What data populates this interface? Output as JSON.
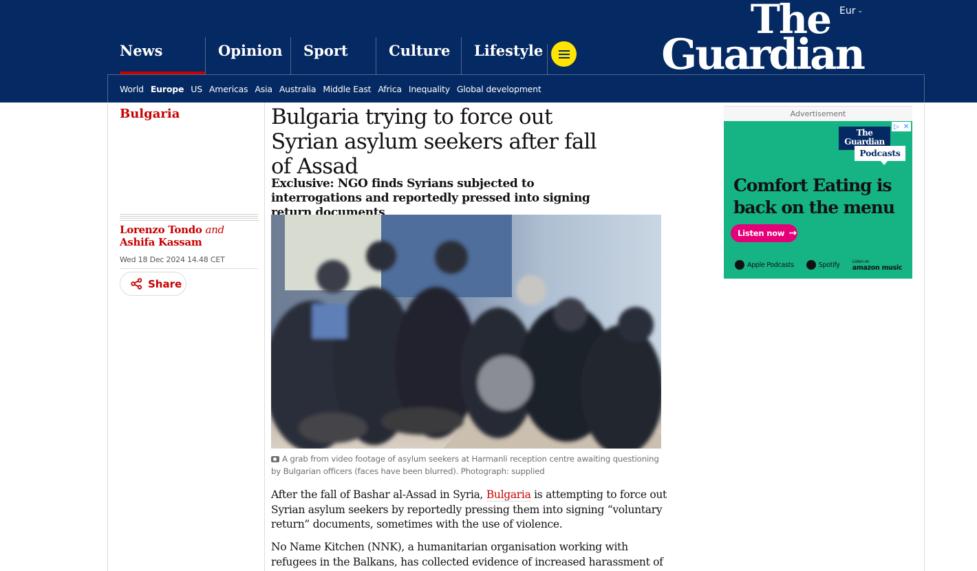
{
  "header": {
    "edition": "Eur",
    "logo_line1": "The",
    "logo_line2": "Guardian",
    "pillars": [
      {
        "label": "News",
        "active": true
      },
      {
        "label": "Opinion",
        "active": false
      },
      {
        "label": "Sport",
        "active": false
      },
      {
        "label": "Culture",
        "active": false
      },
      {
        "label": "Lifestyle",
        "active": false
      }
    ],
    "subnav": [
      {
        "label": "World",
        "current": false
      },
      {
        "label": "Europe",
        "current": true
      },
      {
        "label": "US",
        "current": false
      },
      {
        "label": "Americas",
        "current": false
      },
      {
        "label": "Asia",
        "current": false
      },
      {
        "label": "Australia",
        "current": false
      },
      {
        "label": "Middle East",
        "current": false
      },
      {
        "label": "Africa",
        "current": false
      },
      {
        "label": "Inequality",
        "current": false
      },
      {
        "label": "Global development",
        "current": false
      }
    ],
    "colors": {
      "brand": "#052962",
      "accent": "#c70000",
      "menu_button": "#ffe500"
    }
  },
  "meta": {
    "section": "Bulgaria",
    "author1": "Lorenzo Tondo",
    "and_text": "and",
    "author2": "Ashifa Kassam",
    "date": "Wed 18 Dec 2024 14.48 CET",
    "share_label": "Share"
  },
  "article": {
    "headline": "Bulgaria trying to force out Syrian asylum seekers after fall of Assad",
    "standfirst": "Exclusive: NGO finds Syrians subjected to interrogations and reportedly pressed into signing return documents",
    "caption": "A grab from video footage of asylum seekers at Harmanli reception centre awaiting questioning by Bulgarian officers (faces have been blurred). Photograph: supplied",
    "p1_before": "After the fall of Bashar al-Assad in Syria, ",
    "p1_link": "Bulgaria",
    "p1_after": " is attempting to force out Syrian asylum seekers by reportedly pressing them into signing “voluntary return” documents, sometimes with the use of violence.",
    "p2": "No Name Kitchen (NNK), a humanitarian organisation working with refugees in the Balkans, has collected evidence of increased harassment of Syrian"
  },
  "advert": {
    "label": "Advertisement",
    "logo_top": "The Guardian",
    "logo_bottom": "Podcasts",
    "headline": "Comfort Eating is back on the menu",
    "cta": "Listen now",
    "platforms": [
      "Apple Podcasts",
      "Spotify"
    ],
    "amazon_small": "Listen on",
    "amazon": "amazon music",
    "close_icons": [
      "adchoices-icon",
      "close-icon"
    ]
  }
}
